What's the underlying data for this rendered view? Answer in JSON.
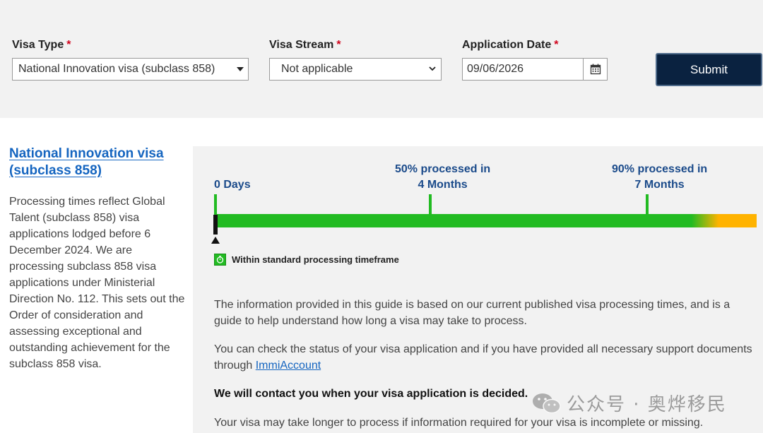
{
  "form": {
    "visa_type": {
      "label": "Visa Type",
      "required_mark": "*",
      "selected": "National Innovation visa (subclass 858)"
    },
    "visa_stream": {
      "label": "Visa Stream",
      "required_mark": "*",
      "selected": "Not applicable"
    },
    "application_date": {
      "label": "Application Date",
      "required_mark": "*",
      "value": "09/06/2026"
    },
    "submit_label": "Submit"
  },
  "result": {
    "title": "National Innovation visa (subclass 858)",
    "description": "Processing times reflect Global Talent (subclass 858) visa applications lodged before 6 December 2024. We are processing subclass 858 visa applications under Ministerial Direction No. 112. This sets out the Order of consideration and assessing exceptional and outstanding achievement for the subclass 858 visa."
  },
  "timeline": {
    "start_line": "0 Days",
    "p50_line1": "50% processed in",
    "p50_line2": "4 Months",
    "p90_line1": "90% processed in",
    "p90_line2": "7 Months",
    "legend": "Within standard processing timeframe",
    "colors": {
      "within": "#22bb22",
      "beyond": "#ffb300",
      "marker": "#111111"
    }
  },
  "info": {
    "p1": "The information provided in this guide is based on our current published visa processing times, and is a guide to help understand how long a visa may take to process.",
    "p2_text": "You can check the status of your visa application and if you have provided all necessary support documents through ",
    "p2_link": "ImmiAccount",
    "p3": "We will contact you when your visa application is decided.",
    "p4": "Your visa may take longer to process if information required for your visa is incomplete or missing."
  },
  "watermark": {
    "text": "公众号 · 奥烨移民",
    "icon": "wechat-icon"
  },
  "colors": {
    "accent": "#1565c0",
    "submit_bg": "#0a2240",
    "band_bg": "#f2f2f2"
  }
}
